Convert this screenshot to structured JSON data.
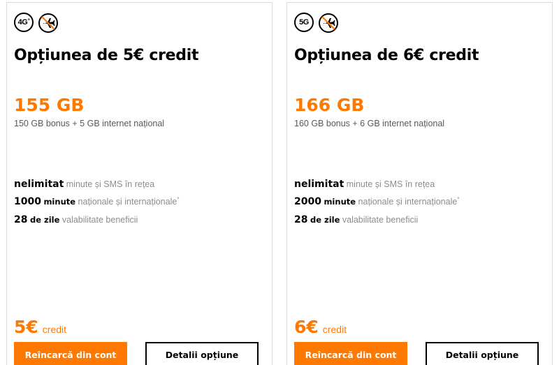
{
  "offers": [
    {
      "network_badge": "4G",
      "network_badge_sup": "+",
      "roaming_icon": "no-roaming-airplane-icon",
      "title": "Opțiunea de 5€ credit",
      "data_amount": "155 GB",
      "data_desc": "150 GB bonus + 5 GB internet național",
      "features": [
        {
          "strong": "nelimitat",
          "text": "minute și SMS în rețea"
        },
        {
          "strong": "1000",
          "strong_small": "minute",
          "text": "naționale și internaționale",
          "asterisk": "*"
        },
        {
          "strong": "28",
          "strong_small": "de zile",
          "text": "valabilitate beneficii"
        }
      ],
      "price_amount": "5€",
      "price_label": "credit",
      "primary_button": "Reîncarcă din cont",
      "secondary_button": "Detalii opțiune"
    },
    {
      "network_badge": "5G",
      "network_badge_sup": "",
      "roaming_icon": "no-roaming-airplane-icon",
      "title": "Opțiunea de 6€ credit",
      "data_amount": "166 GB",
      "data_desc": "160 GB bonus + 6 GB internet național",
      "features": [
        {
          "strong": "nelimitat",
          "text": "minute și SMS în rețea"
        },
        {
          "strong": "2000",
          "strong_small": "minute",
          "text": "naționale și internaționale",
          "asterisk": "*"
        },
        {
          "strong": "28",
          "strong_small": "de zile",
          "text": "valabilitate beneficii"
        }
      ],
      "price_amount": "6€",
      "price_label": "credit",
      "primary_button": "Reîncarcă din cont",
      "secondary_button": "Detalii opțiune"
    }
  ],
  "colors": {
    "accent": "#ff7900",
    "text": "#000000",
    "muted": "#8c8c8c",
    "border": "#dcdcdc"
  }
}
